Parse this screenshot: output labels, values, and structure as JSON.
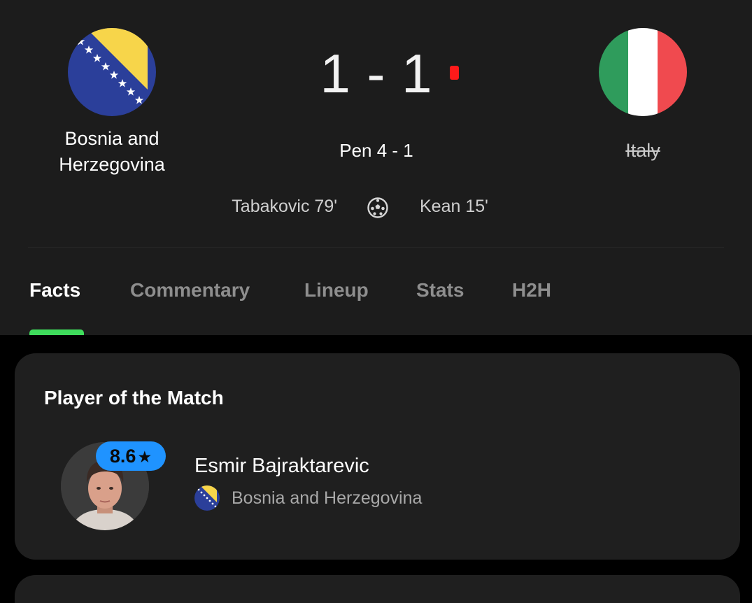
{
  "match": {
    "home_team": {
      "name": "Bosnia and Herzegovina",
      "flag_icon": "bosnia-flag-icon",
      "scorers": "Tabakovic 79'"
    },
    "away_team": {
      "name": "Italy",
      "flag_icon": "italy-flag-icon",
      "scorers": "Kean 15'"
    },
    "score": "1 - 1",
    "penalties": "Pen 4 - 1",
    "goal_icon": "soccer-ball-icon",
    "live_indicator_color": "#ff1a1a"
  },
  "tabs": [
    {
      "label": "Facts",
      "active": true
    },
    {
      "label": "Commentary",
      "active": false
    },
    {
      "label": "Lineup",
      "active": false
    },
    {
      "label": "Stats",
      "active": false
    },
    {
      "label": "H2H",
      "active": false
    }
  ],
  "player_of_the_match": {
    "title": "Player of the Match",
    "rating": "8.6",
    "rating_icon": "star-icon",
    "player_name": "Esmir Bajraktarevic",
    "team_name": "Bosnia and Herzegovina",
    "team_flag_icon": "bosnia-flag-icon"
  },
  "colors": {
    "header_bg": "#1c1c1c",
    "card_bg": "#1f1f1f",
    "accent_green": "#3fdc5c",
    "rating_blue": "#1f93ff",
    "bosnia_blue": "#2b3f9a",
    "bosnia_yellow": "#f7d54a",
    "italy_green": "#2f9c5c",
    "italy_red": "#f04a4f"
  }
}
